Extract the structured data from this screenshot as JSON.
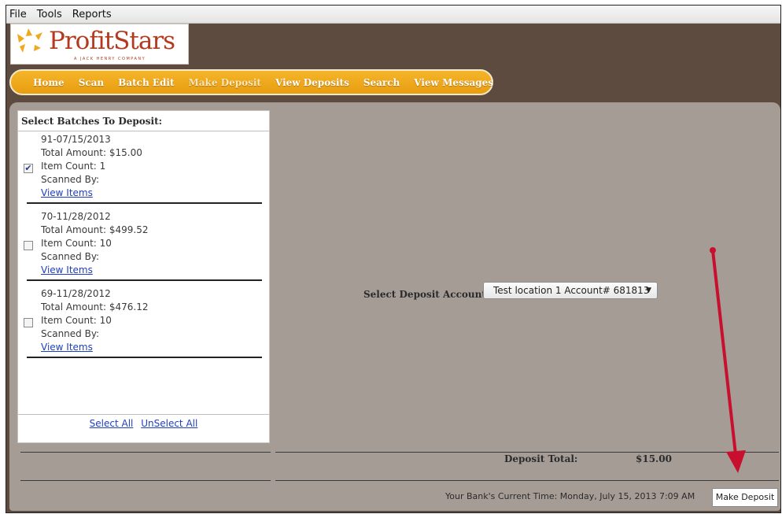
{
  "menu": {
    "items": [
      {
        "label": "File"
      },
      {
        "label": "Tools"
      },
      {
        "label": "Reports"
      }
    ]
  },
  "logo": {
    "name": "ProfitStars",
    "tagline": "A JACK HENRY COMPANY"
  },
  "nav": {
    "items": [
      {
        "label": "Home"
      },
      {
        "label": "Scan"
      },
      {
        "label": "Batch Edit"
      },
      {
        "label": "Make Deposit"
      },
      {
        "label": "View Deposits"
      },
      {
        "label": "Search"
      },
      {
        "label": "View Messages"
      }
    ],
    "active": "Make Deposit"
  },
  "batches": {
    "title": "Select Batches To Deposit:",
    "items": [
      {
        "id_date": "91-07/15/2013",
        "total": "Total Amount: $15.00",
        "count": "Item Count: 1",
        "scanned": "Scanned By:",
        "link": "View Items",
        "checked": true
      },
      {
        "id_date": "70-11/28/2012",
        "total": "Total Amount: $499.52",
        "count": "Item Count: 10",
        "scanned": "Scanned By:",
        "link": "View Items",
        "checked": false
      },
      {
        "id_date": "69-11/28/2012",
        "total": "Total Amount: $476.12",
        "count": "Item Count: 10",
        "scanned": "Scanned By:",
        "link": "View Items",
        "checked": false
      }
    ],
    "select_all": "Select All",
    "unselect_all": "UnSelect All"
  },
  "account": {
    "label": "Select Deposit Account:",
    "selected": "Test location 1 Account# 681813"
  },
  "deposit_total": {
    "label": "Deposit Total:",
    "value": "$15.00"
  },
  "bank_time": "Your Bank's Current Time: Monday, July 15, 2013 7:09 AM",
  "make_deposit_label": "Make Deposit",
  "colors": {
    "frame": "#5c4b3e",
    "content": "#a69c96",
    "nav_gold": "#f0a81d",
    "annotation_arrow": "#c8102e"
  },
  "icons": {
    "logo_star": "star-burst-icon",
    "check": "check-icon",
    "caret": "caret-down-icon",
    "arrow": "annotation-arrow-icon"
  }
}
